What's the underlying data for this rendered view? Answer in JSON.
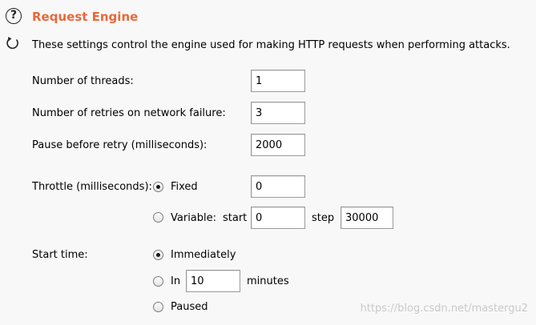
{
  "header": {
    "help_icon_glyph": "?",
    "title": "Request Engine",
    "description": "These settings control the engine used for making HTTP requests when performing attacks."
  },
  "threads": {
    "label": "Number of threads:",
    "value": "1"
  },
  "retries": {
    "label": "Number of retries on network failure:",
    "value": "3"
  },
  "pause": {
    "label": "Pause before retry (milliseconds):",
    "value": "2000"
  },
  "throttle": {
    "label": "Throttle (milliseconds):",
    "fixed_label": "Fixed",
    "fixed_value": "0",
    "variable_label": "Variable:",
    "start_label": "start",
    "start_value": "0",
    "step_label": "step",
    "step_value": "30000",
    "selected": "fixed"
  },
  "start_time": {
    "label": "Start time:",
    "immediately_label": "Immediately",
    "in_label": "In",
    "in_value": "10",
    "minutes_label": "minutes",
    "paused_label": "Paused",
    "selected": "immediately"
  },
  "watermark": "https://blog.csdn.net/mastergu2",
  "colors": {
    "title": "#e8693a",
    "background": "#f8f8f8"
  }
}
